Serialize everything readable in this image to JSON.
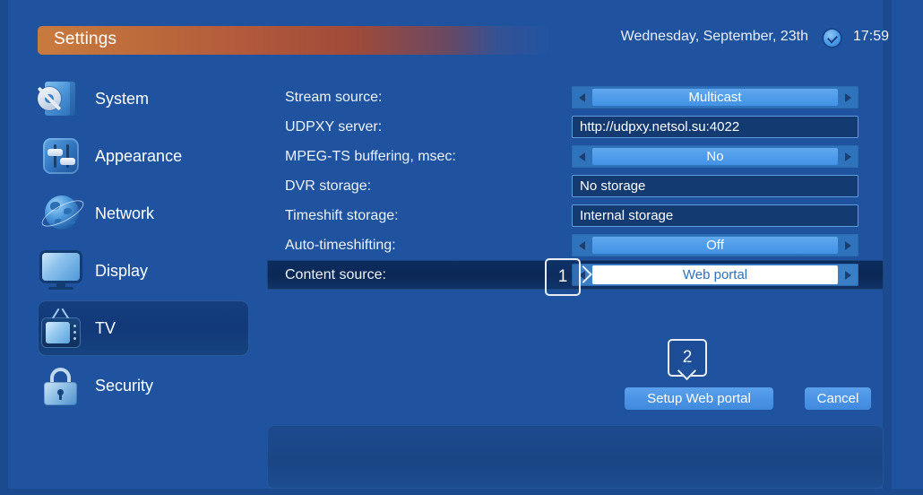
{
  "header": {
    "title": "Settings",
    "date": "Wednesday, September, 23th",
    "time": "17:59",
    "clock_icon": "clock-icon"
  },
  "sidebar": {
    "items": [
      {
        "label": "System",
        "icon": "system-gear-box-icon",
        "selected": false
      },
      {
        "label": "Appearance",
        "icon": "sliders-icon",
        "selected": false
      },
      {
        "label": "Network",
        "icon": "globe-icon",
        "selected": false
      },
      {
        "label": "Display",
        "icon": "monitor-icon",
        "selected": false
      },
      {
        "label": "TV",
        "icon": "tv-icon",
        "selected": true
      },
      {
        "label": "Security",
        "icon": "padlock-icon",
        "selected": false
      }
    ]
  },
  "form": {
    "rows": [
      {
        "label": "Stream source:",
        "type": "spinner",
        "value": "Multicast",
        "selected": false
      },
      {
        "label": "UDPXY server:",
        "type": "textbox",
        "value": "http://udpxy.netsol.su:4022",
        "selected": false
      },
      {
        "label": "MPEG-TS buffering, msec:",
        "type": "spinner",
        "value": "No",
        "selected": false
      },
      {
        "label": "DVR storage:",
        "type": "textbox",
        "value": "No storage",
        "selected": false
      },
      {
        "label": "Timeshift storage:",
        "type": "textbox",
        "value": "Internal storage",
        "selected": false
      },
      {
        "label": "Auto-timeshifting:",
        "type": "spinner",
        "value": "Off",
        "selected": false
      },
      {
        "label": "Content source:",
        "type": "spinner",
        "value": "Web portal",
        "selected": true
      }
    ]
  },
  "markers": {
    "one": "1",
    "two": "2"
  },
  "buttons": {
    "setup": "Setup Web portal",
    "cancel": "Cancel"
  },
  "colors": {
    "background": "#1f53a0",
    "title_gradient_start": "#c97b3e",
    "title_gradient_end": "#a04a39",
    "selected_row": "#0b2855",
    "accent": "#4a93e4"
  }
}
